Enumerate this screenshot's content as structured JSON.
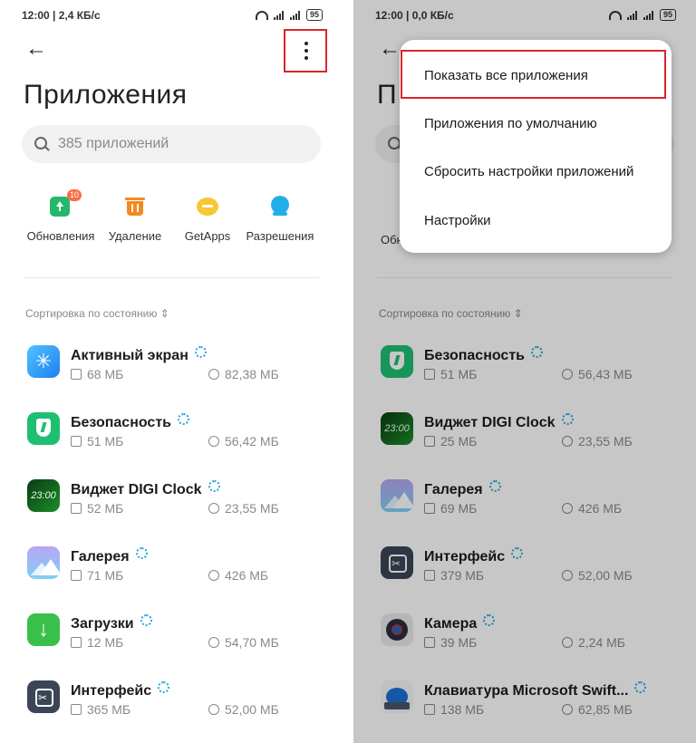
{
  "left": {
    "status": {
      "time_speed": "12:00 | 2,4 КБ/с",
      "battery": "95"
    },
    "title": "Приложения",
    "search_placeholder": "385 приложений",
    "quick_actions": [
      {
        "label": "Обновления",
        "icon": "update-icon",
        "badge": "10"
      },
      {
        "label": "Удаление",
        "icon": "trash-icon"
      },
      {
        "label": "GetApps",
        "icon": "getapps-icon"
      },
      {
        "label": "Разрешения",
        "icon": "permissions-icon"
      }
    ],
    "sort_label": "Сортировка по состоянию",
    "apps": [
      {
        "name": "Активный экран",
        "size": "68 МБ",
        "data": "82,38 МБ",
        "icon": "active-screen-icon"
      },
      {
        "name": "Безопасность",
        "size": "51 МБ",
        "data": "56,42 МБ",
        "icon": "security-icon"
      },
      {
        "name": "Виджет DIGI Clock",
        "size": "52 МБ",
        "data": "23,55 МБ",
        "icon": "digi-clock-icon",
        "icon_text": "23:00"
      },
      {
        "name": "Галерея",
        "size": "71 МБ",
        "data": "426 МБ",
        "icon": "gallery-icon"
      },
      {
        "name": "Загрузки",
        "size": "12 МБ",
        "data": "54,70 МБ",
        "icon": "downloads-icon"
      },
      {
        "name": "Интерфейс",
        "size": "365 МБ",
        "data": "52,00 МБ",
        "icon": "interface-icon"
      }
    ]
  },
  "right": {
    "status": {
      "time_speed": "12:00 | 0,0 КБ/с",
      "battery": "95"
    },
    "title_partial": "П",
    "quick_partial": "Обн",
    "sort_label": "Сортировка по состоянию",
    "menu": {
      "items": [
        "Показать все приложения",
        "Приложения по умолчанию",
        "Сбросить настройки приложений",
        "Настройки"
      ]
    },
    "apps": [
      {
        "name": "Безопасность",
        "size": "51 МБ",
        "data": "56,43 МБ",
        "icon": "security-icon"
      },
      {
        "name": "Виджет DIGI Clock",
        "size": "25 МБ",
        "data": "23,55 МБ",
        "icon": "digi-clock-icon",
        "icon_text": "23:00"
      },
      {
        "name": "Галерея",
        "size": "69 МБ",
        "data": "426 МБ",
        "icon": "gallery-icon"
      },
      {
        "name": "Интерфейс",
        "size": "379 МБ",
        "data": "52,00 МБ",
        "icon": "interface-icon"
      },
      {
        "name": "Камера",
        "size": "39 МБ",
        "data": "2,24 МБ",
        "icon": "camera-icon"
      },
      {
        "name": "Клавиатура Microsoft Swift...",
        "size": "138 МБ",
        "data": "62,85 МБ",
        "icon": "keyboard-icon"
      }
    ]
  },
  "colors": {
    "highlight": "#d9262c",
    "loading": "#29a8e0",
    "secondary_text": "#8a8a8a"
  }
}
